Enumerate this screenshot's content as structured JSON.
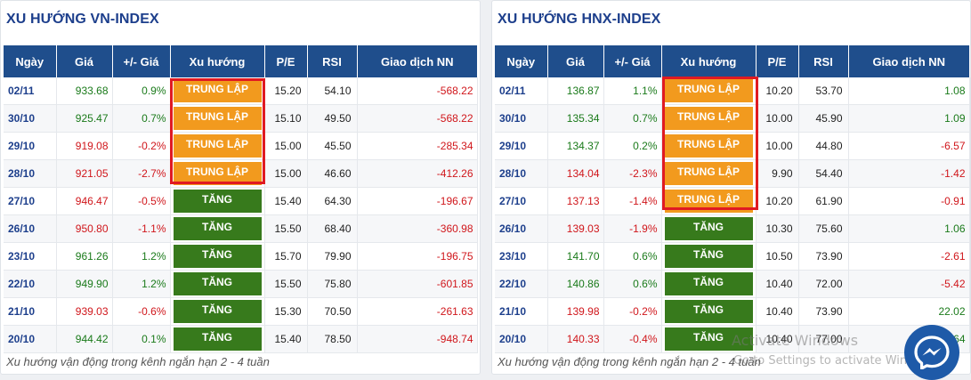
{
  "vn": {
    "title": "XU HƯỚNG VN-INDEX",
    "headers": [
      "Ngày",
      "Giá",
      "+/- Giá",
      "Xu hướng",
      "P/E",
      "RSI",
      "Giao dịch NN"
    ],
    "rows": [
      {
        "date": "02/11",
        "price": "933.68",
        "change": "0.9%",
        "trend": "TRUNG LẬP",
        "pe": "15.20",
        "rsi": "54.10",
        "foreign": "-568.22"
      },
      {
        "date": "30/10",
        "price": "925.47",
        "change": "0.7%",
        "trend": "TRUNG LẬP",
        "pe": "15.10",
        "rsi": "49.50",
        "foreign": "-568.22"
      },
      {
        "date": "29/10",
        "price": "919.08",
        "change": "-0.2%",
        "trend": "TRUNG LẬP",
        "pe": "15.00",
        "rsi": "45.50",
        "foreign": "-285.34"
      },
      {
        "date": "28/10",
        "price": "921.05",
        "change": "-2.7%",
        "trend": "TRUNG LẬP",
        "pe": "15.00",
        "rsi": "46.60",
        "foreign": "-412.26"
      },
      {
        "date": "27/10",
        "price": "946.47",
        "change": "-0.5%",
        "trend": "TĂNG",
        "pe": "15.40",
        "rsi": "64.30",
        "foreign": "-196.67"
      },
      {
        "date": "26/10",
        "price": "950.80",
        "change": "-1.1%",
        "trend": "TĂNG",
        "pe": "15.50",
        "rsi": "68.40",
        "foreign": "-360.98"
      },
      {
        "date": "23/10",
        "price": "961.26",
        "change": "1.2%",
        "trend": "TĂNG",
        "pe": "15.70",
        "rsi": "79.90",
        "foreign": "-196.75"
      },
      {
        "date": "22/10",
        "price": "949.90",
        "change": "1.2%",
        "trend": "TĂNG",
        "pe": "15.50",
        "rsi": "75.80",
        "foreign": "-601.85"
      },
      {
        "date": "21/10",
        "price": "939.03",
        "change": "-0.6%",
        "trend": "TĂNG",
        "pe": "15.30",
        "rsi": "70.50",
        "foreign": "-261.63"
      },
      {
        "date": "20/10",
        "price": "944.42",
        "change": "0.1%",
        "trend": "TĂNG",
        "pe": "15.40",
        "rsi": "78.50",
        "foreign": "-948.74"
      }
    ],
    "footnote": "Xu hướng vận động trong kênh ngắn hạn 2 - 4 tuần"
  },
  "hnx": {
    "title": "XU HƯỚNG HNX-INDEX",
    "headers": [
      "Ngày",
      "Giá",
      "+/- Giá",
      "Xu hướng",
      "P/E",
      "RSI",
      "Giao dịch NN"
    ],
    "rows": [
      {
        "date": "02/11",
        "price": "136.87",
        "change": "1.1%",
        "trend": "TRUNG LẬP",
        "pe": "10.20",
        "rsi": "53.70",
        "foreign": "1.08"
      },
      {
        "date": "30/10",
        "price": "135.34",
        "change": "0.7%",
        "trend": "TRUNG LẬP",
        "pe": "10.00",
        "rsi": "45.90",
        "foreign": "1.09"
      },
      {
        "date": "29/10",
        "price": "134.37",
        "change": "0.2%",
        "trend": "TRUNG LẬP",
        "pe": "10.00",
        "rsi": "44.80",
        "foreign": "-6.57"
      },
      {
        "date": "28/10",
        "price": "134.04",
        "change": "-2.3%",
        "trend": "TRUNG LẬP",
        "pe": "9.90",
        "rsi": "54.40",
        "foreign": "-1.42"
      },
      {
        "date": "27/10",
        "price": "137.13",
        "change": "-1.4%",
        "trend": "TRUNG LẬP",
        "pe": "10.20",
        "rsi": "61.90",
        "foreign": "-0.91"
      },
      {
        "date": "26/10",
        "price": "139.03",
        "change": "-1.9%",
        "trend": "TĂNG",
        "pe": "10.30",
        "rsi": "75.60",
        "foreign": "1.06"
      },
      {
        "date": "23/10",
        "price": "141.70",
        "change": "0.6%",
        "trend": "TĂNG",
        "pe": "10.50",
        "rsi": "73.90",
        "foreign": "-2.61"
      },
      {
        "date": "22/10",
        "price": "140.86",
        "change": "0.6%",
        "trend": "TĂNG",
        "pe": "10.40",
        "rsi": "72.00",
        "foreign": "-5.42"
      },
      {
        "date": "21/10",
        "price": "139.98",
        "change": "-0.2%",
        "trend": "TĂNG",
        "pe": "10.40",
        "rsi": "73.90",
        "foreign": "22.02"
      },
      {
        "date": "20/10",
        "price": "140.33",
        "change": "-0.4%",
        "trend": "TĂNG",
        "pe": "10.40",
        "rsi": "77.00",
        "foreign": "6.64"
      }
    ],
    "footnote": "Xu hướng vận động trong kênh ngắn hạn 2 - 4 tuần"
  },
  "watermark": {
    "line1": "Activate Windows",
    "line2": "Go to Settings to activate Windows."
  },
  "colors": {
    "header_bg": "#1f4e8c",
    "title": "#1d3f8c",
    "neutral_badge": "#f29a1e",
    "up_badge": "#377a1c",
    "positive": "#1a7a1a",
    "negative": "#d0161b",
    "highlight": "#e01a22"
  },
  "icons": {
    "chat": "messenger-icon"
  }
}
